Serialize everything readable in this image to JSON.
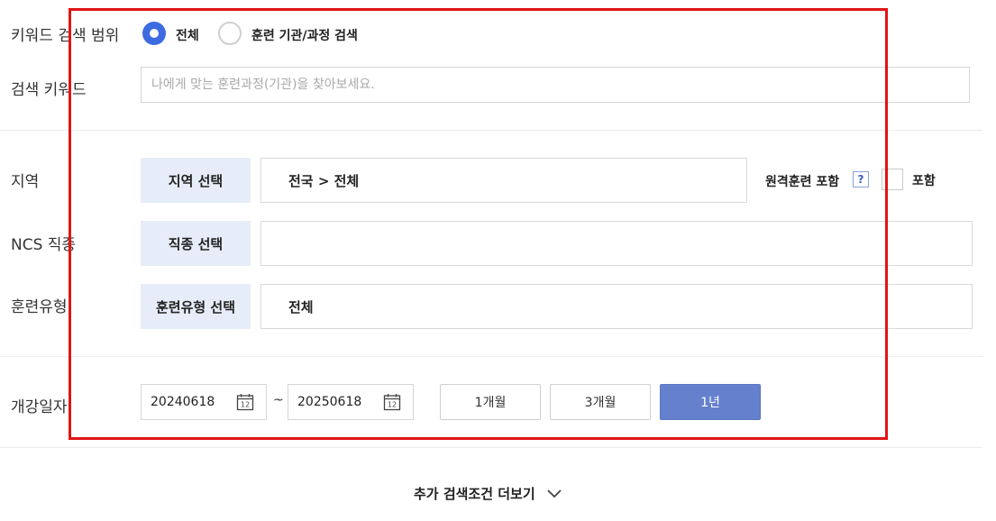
{
  "keyword_scope": {
    "label": "키워드 검색 범위",
    "options": [
      {
        "label": "전체",
        "selected": true
      },
      {
        "label": "훈련 기관/과정 검색",
        "selected": false
      }
    ]
  },
  "search_keyword": {
    "label": "검색 키워드",
    "placeholder": "나에게 맞는 훈련과정(기관)을 찾아보세요.",
    "value": ""
  },
  "region": {
    "label": "지역",
    "button_label": "지역 선택",
    "value": "전국 > 전체",
    "remote_label": "원격훈련 포함",
    "help_icon": "?",
    "include_label": "포함"
  },
  "ncs": {
    "label": "NCS 직종",
    "button_label": "직종 선택",
    "value": ""
  },
  "training_type": {
    "label": "훈련유형",
    "button_label": "훈련유형 선택",
    "value": "전체"
  },
  "start_date": {
    "label": "개강일자",
    "from": "20240618",
    "separator": "~",
    "to": "20250618",
    "calendar_day": "12",
    "periods": [
      {
        "label": "1개월",
        "active": false
      },
      {
        "label": "3개월",
        "active": false
      },
      {
        "label": "1년",
        "active": true
      }
    ]
  },
  "more_conditions": {
    "label": "추가 검색조건 더보기"
  },
  "colors": {
    "radio_selected": "#3d6be2",
    "select_button_bg": "#e6edf8",
    "active_period_bg": "#6580cc",
    "highlight_frame": "#e01515"
  },
  "icons": [
    "calendar-icon",
    "chevron-down-icon",
    "help-icon"
  ]
}
